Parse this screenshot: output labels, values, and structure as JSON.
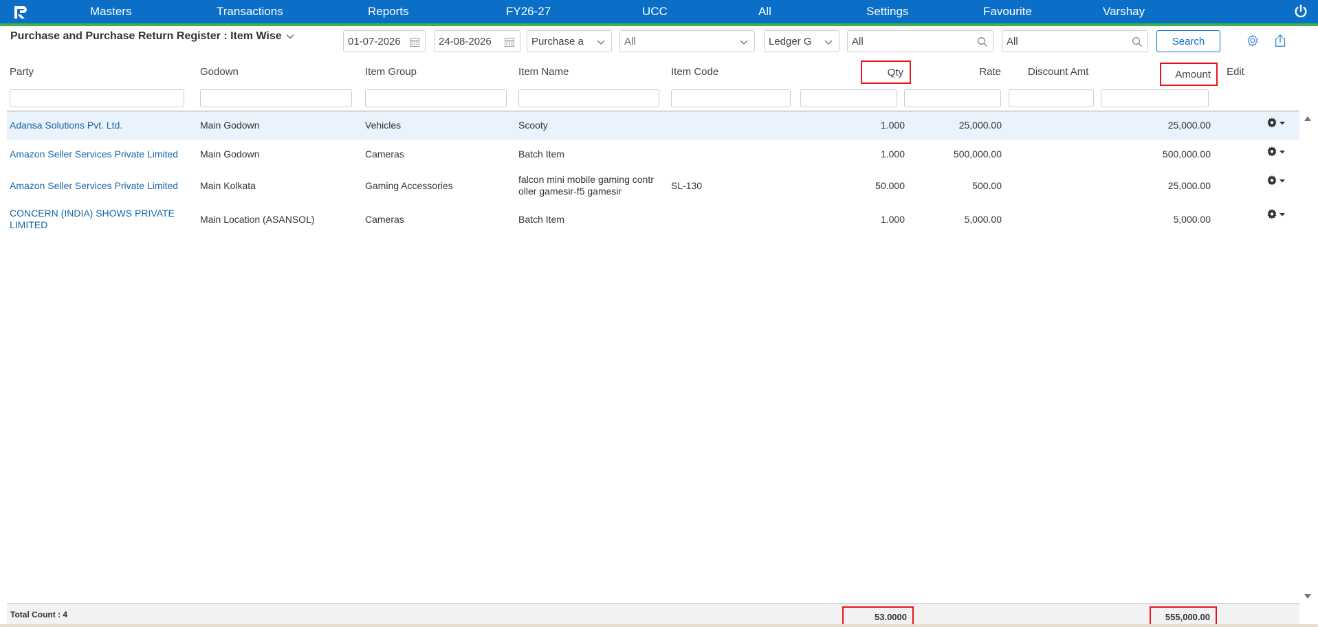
{
  "nav": {
    "items": [
      "Masters",
      "Transactions",
      "Reports",
      "FY26-27",
      "UCC",
      "All",
      "Settings",
      "Favourite",
      "Varshay"
    ]
  },
  "report": {
    "title": "Purchase and Purchase Return Register : Item Wise"
  },
  "filters": {
    "from_date": "01-07-2026",
    "to_date": "24-08-2026",
    "voucher_type": "Purchase a",
    "select_all": "All",
    "ledger_group": "Ledger G",
    "search1": "All",
    "search2": "All",
    "search_button": "Search"
  },
  "columns": {
    "party": "Party",
    "godown": "Godown",
    "item_group": "Item Group",
    "item_name": "Item Name",
    "item_code": "Item Code",
    "qty": "Qty",
    "rate": "Rate",
    "discount": "Discount Amt",
    "amount": "Amount",
    "edit": "Edit"
  },
  "rows": [
    {
      "party": "Adansa Solutions Pvt. Ltd.",
      "godown": "Main Godown",
      "item_group": "Vehicles",
      "item_name": "Scooty",
      "item_code": "",
      "qty": "1.000",
      "rate": "25,000.00",
      "discount": "",
      "amount": "25,000.00"
    },
    {
      "party": "Amazon Seller Services Private Limited",
      "godown": "Main Godown",
      "item_group": "Cameras",
      "item_name": "Batch Item",
      "item_code": "",
      "qty": "1.000",
      "rate": "500,000.00",
      "discount": "",
      "amount": "500,000.00"
    },
    {
      "party": "Amazon Seller Services Private Limited",
      "godown": "Main Kolkata",
      "item_group": "Gaming Accessories",
      "item_name": "falcon mini mobile gaming contr oller gamesir-f5 gamesir",
      "item_code": "SL-130",
      "qty": "50.000",
      "rate": "500.00",
      "discount": "",
      "amount": "25,000.00"
    },
    {
      "party": "CONCERN (INDIA) SHOWS PRIVATE LIMITED",
      "godown": "Main Location (ASANSOL)",
      "item_group": "Cameras",
      "item_name": "Batch Item",
      "item_code": "",
      "qty": "1.000",
      "rate": "5,000.00",
      "discount": "",
      "amount": "5,000.00"
    }
  ],
  "footer": {
    "total_count": "Total Count : 4",
    "qty_total": "53.0000",
    "amount_total": "555,000.00"
  },
  "colors": {
    "topbar": "#0b6fc7",
    "topbar_border": "#39b54a",
    "highlight": "#e8141a",
    "link": "#1565a9"
  }
}
